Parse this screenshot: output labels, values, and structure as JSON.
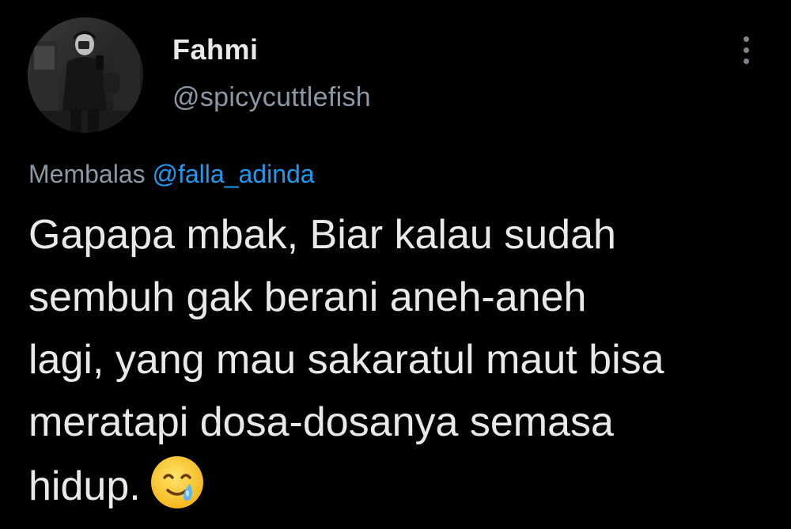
{
  "author": {
    "display_name": "Fahmi",
    "handle": "@spicycuttlefish",
    "avatar_icon": "user-photo-avatar"
  },
  "menu": {
    "icon": "more-vertical-icon"
  },
  "reply": {
    "prefix": "Membalas",
    "mention": "@falla_adinda"
  },
  "tweet": {
    "lines": [
      "Gapapa mbak, Biar kalau sudah",
      "sembuh gak berani aneh-aneh",
      "lagi, yang mau sakaratul maut bisa",
      "meratapi dosa-dosanya semasa",
      "hidup."
    ],
    "emoji": "face-holding-back-tears-emoji"
  },
  "colors": {
    "background": "#000000",
    "text": "#e7e9ea",
    "secondary": "#8b98a5",
    "accent": "#1d9bf0"
  }
}
